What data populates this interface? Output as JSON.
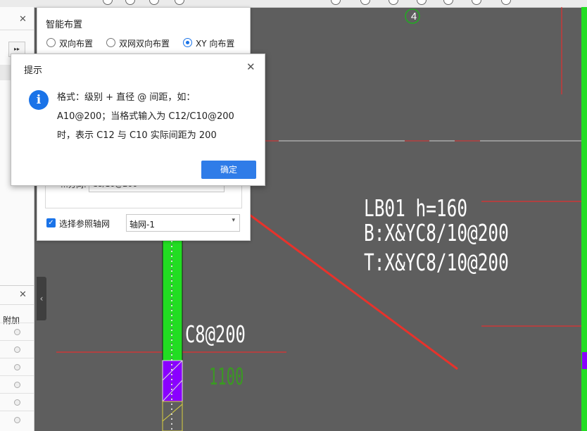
{
  "colors": {
    "canvas_bg": "#5e5e5e",
    "accent_blue": "#1a73e8",
    "wall_green": "#22dd22",
    "cad_red": "#e23030",
    "cad_purple": "#8a00ff",
    "annotation_arrow": "#e8322b"
  },
  "left_panel": {
    "close_glyph_top": "✕",
    "close_glyph_bottom": "✕",
    "expand_button": "▸▸",
    "column_header_fujia": "附加",
    "collapse_glyph": "‹"
  },
  "smart_layout": {
    "title": "智能布置",
    "options": [
      {
        "label": "双向布置",
        "selected": false
      },
      {
        "label": "双网双向布置",
        "selected": false
      },
      {
        "label": "XY 向布置",
        "selected": true
      }
    ],
    "partial_input_label": "…方向:",
    "partial_input_value": "C8/10@200",
    "checkbox_label": "选择参照轴网",
    "checkbox_checked": true,
    "checkbox_glyph": "✓",
    "grid_select": "轴网-1",
    "select_caret": "▾"
  },
  "dialog": {
    "title": "提示",
    "close_glyph": "✕",
    "icon": "info-icon",
    "icon_glyph": "i",
    "message_lines": [
      "格式：级别 + 直径 @ 间距，如：",
      "A10@200；当格式输入为 C12/C10@200",
      "时，表示 C12 与 C10 实际间距为 200"
    ],
    "ok_label": "确定"
  },
  "cad": {
    "axis_marker": "4",
    "slab_label_line1": "LB01 h=160",
    "slab_label_line2": "B:X&YC8/10@200",
    "slab_label_line3": "T:X&YC8/10@200",
    "rebar_label": "C8@200",
    "dimension_label": "1100"
  }
}
